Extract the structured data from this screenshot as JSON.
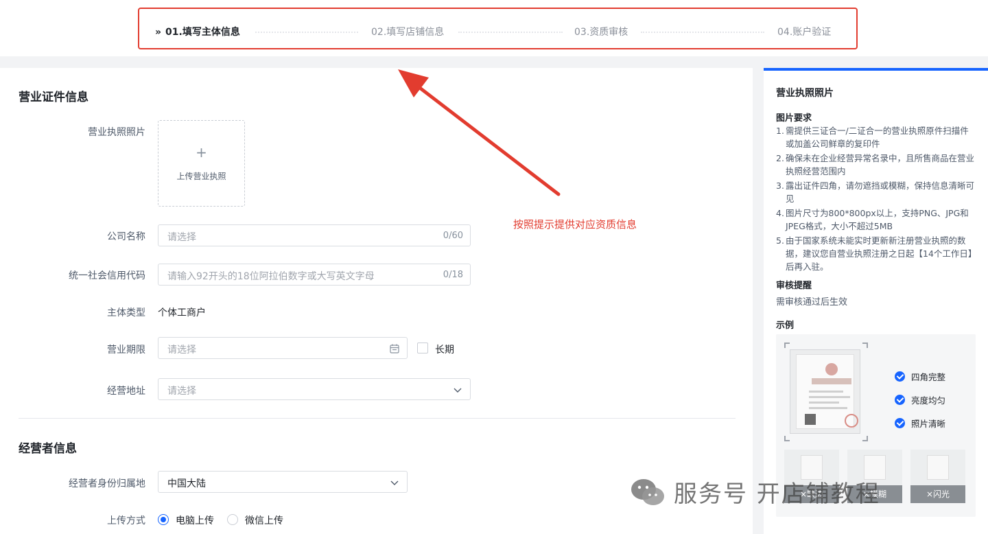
{
  "steps": [
    {
      "label": "01.填写主体信息",
      "arrow": "»"
    },
    {
      "label": "02.填写店铺信息"
    },
    {
      "label": "03.资质审核"
    },
    {
      "label": "04.账户验证"
    }
  ],
  "business_section": {
    "title": "营业证件信息",
    "license_photo_label": "营业执照照片",
    "upload_plus": "+",
    "upload_text": "上传营业执照",
    "company_name_label": "公司名称",
    "company_name_placeholder": "请选择",
    "company_name_count": "0/60",
    "credit_code_label": "统一社会信用代码",
    "credit_code_placeholder": "请输入92开头的18位阿拉伯数字或大写英文字母",
    "credit_code_count": "0/18",
    "entity_type_label": "主体类型",
    "entity_type_value": "个体工商户",
    "term_label": "营业期限",
    "term_placeholder": "请选择",
    "long_term_label": "长期",
    "address_label": "经营地址",
    "address_placeholder": "请选择"
  },
  "operator_section": {
    "title": "经营者信息",
    "id_region_label": "经营者身份归属地",
    "id_region_value": "中国大陆",
    "upload_method_label": "上传方式",
    "upload_options": [
      "电脑上传",
      "微信上传"
    ],
    "upload_selected": "电脑上传"
  },
  "annotation": {
    "text": "按照提示提供对应资质信息",
    "color": "#e23c2f"
  },
  "side_panel": {
    "title": "营业执照照片",
    "requirements_title": "图片要求",
    "requirements": [
      {
        "n": "1.",
        "text": "需提供三证合一/二证合一的营业执照原件扫描件或加盖公司鲜章的复印件"
      },
      {
        "n": "2.",
        "text": "确保未在企业经营异常名录中，且所售商品在营业执照经营范围内"
      },
      {
        "n": "3.",
        "text": "露出证件四角，请勿遮挡或模糊，保持信息清晰可见"
      },
      {
        "n": "4.",
        "text": "图片尺寸为800*800px以上，支持PNG、JPG和JPEG格式，大小不超过5MB"
      },
      {
        "n": "5.",
        "text": "由于国家系统未能实时更新新注册营业执照的数据，建议您自营业执照注册之日起【14个工作日】后再入驻。"
      }
    ],
    "review_title": "审核提醒",
    "review_text": "需审核通过后生效",
    "sample_title": "示例",
    "checks": [
      "四角完整",
      "亮度均匀",
      "照片清晰"
    ],
    "thumb_tags": [
      "×缺边",
      "×模糊",
      "×闪光"
    ]
  },
  "watermark": {
    "text": "服务号 开店铺教程"
  },
  "colors": {
    "accent": "#1664ff",
    "annotation_red": "#e23c2f"
  }
}
